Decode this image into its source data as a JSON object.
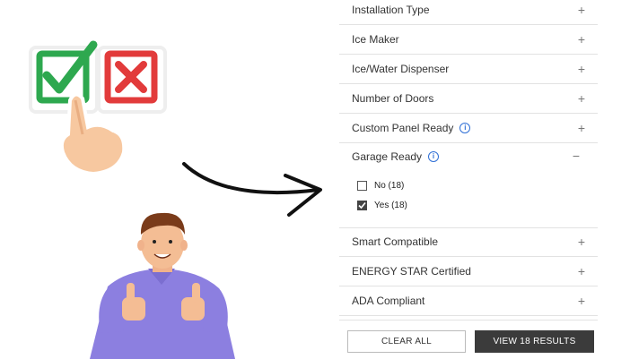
{
  "filters": {
    "installation_type": {
      "label": "Installation Type",
      "toggle": "+"
    },
    "ice_maker": {
      "label": "Ice Maker",
      "toggle": "+"
    },
    "ice_water_dispenser": {
      "label": "Ice/Water Dispenser",
      "toggle": "+"
    },
    "number_of_doors": {
      "label": "Number of Doors",
      "toggle": "+"
    },
    "custom_panel_ready": {
      "label": "Custom Panel Ready",
      "toggle": "+",
      "info": "i"
    },
    "garage_ready": {
      "label": "Garage Ready",
      "toggle": "−",
      "info": "i",
      "options": [
        {
          "label": "No (18)",
          "checked": false
        },
        {
          "label": "Yes (18)",
          "checked": true
        }
      ]
    },
    "smart_compatible": {
      "label": "Smart Compatible",
      "toggle": "+"
    },
    "energy_star": {
      "label": "ENERGY STAR Certified",
      "toggle": "+"
    },
    "ada_compliant": {
      "label": "ADA Compliant",
      "toggle": "+"
    }
  },
  "buttons": {
    "clear_all": "CLEAR ALL",
    "view_results": "VIEW 18 RESULTS"
  },
  "colors": {
    "info_blue": "#2f6fd6",
    "check_green": "#2ea84f",
    "cross_red": "#e23b3b",
    "shirt_purple": "#8c7fe0",
    "dark_button": "#3b3b3b"
  }
}
